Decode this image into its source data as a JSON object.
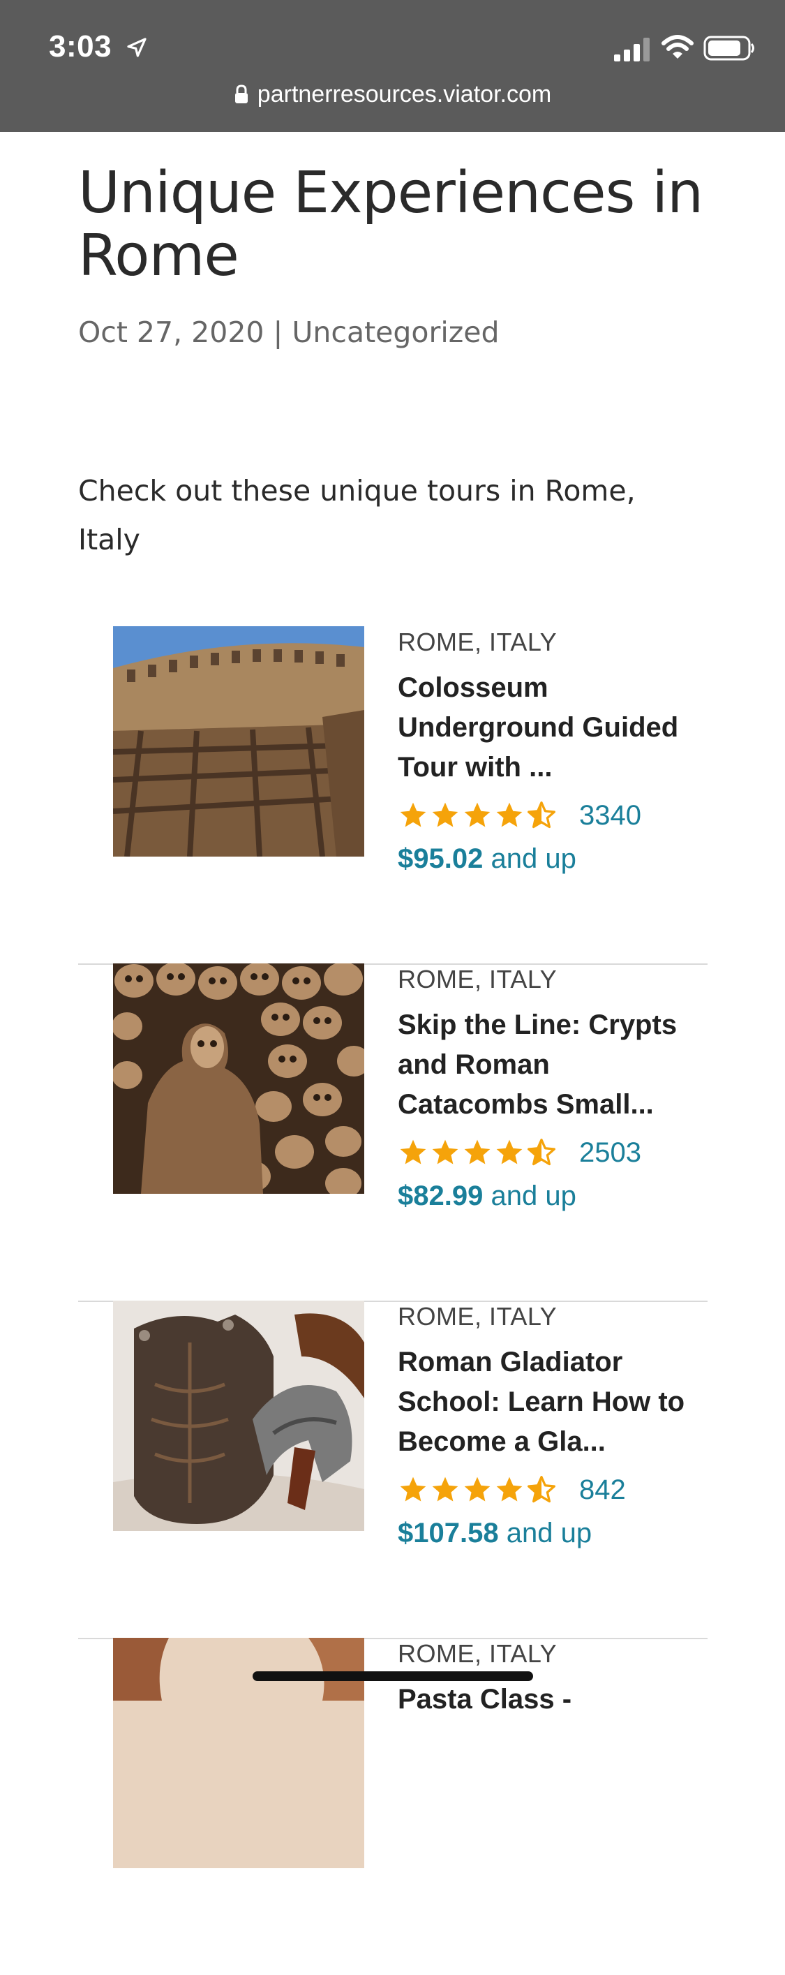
{
  "status_bar": {
    "time": "3:03",
    "icons": [
      "location-arrow-icon",
      "signal-icon",
      "wifi-icon",
      "battery-icon"
    ]
  },
  "browser": {
    "url": "partnerresources.viator.com",
    "url_icon": "lock-icon"
  },
  "article": {
    "title": "Unique Experiences in Rome",
    "date": "Oct 27, 2020",
    "separator": "|",
    "category": "Uncategorized",
    "intro": "Check out these unique tours in Rome, Italy"
  },
  "products": [
    {
      "location": "ROME, ITALY",
      "title": "Colosseum Underground Guided Tour with ...",
      "rating": 4.5,
      "reviews": "3340",
      "price": "$95.02",
      "price_suffix": "and up",
      "image": "colosseum-photo"
    },
    {
      "location": "ROME, ITALY",
      "title": "Skip the Line: Crypts and Roman Catacombs Small...",
      "rating": 4.5,
      "reviews": "2503",
      "price": "$82.99",
      "price_suffix": "and up",
      "image": "skull-crypt-photo"
    },
    {
      "location": "ROME, ITALY",
      "title": "Roman Gladiator School: Learn How to Become a Gla...",
      "rating": 4.5,
      "reviews": "842",
      "price": "$107.58",
      "price_suffix": "and up",
      "image": "gladiator-armor-photo"
    },
    {
      "location": "ROME, ITALY",
      "title": "Pasta Class -",
      "image": "pasta-class-photo"
    }
  ],
  "colors": {
    "chrome": "#5b5b5b",
    "accent": "#1a7f9a",
    "star": "#f5a30a",
    "divider": "#d9d9d9"
  }
}
